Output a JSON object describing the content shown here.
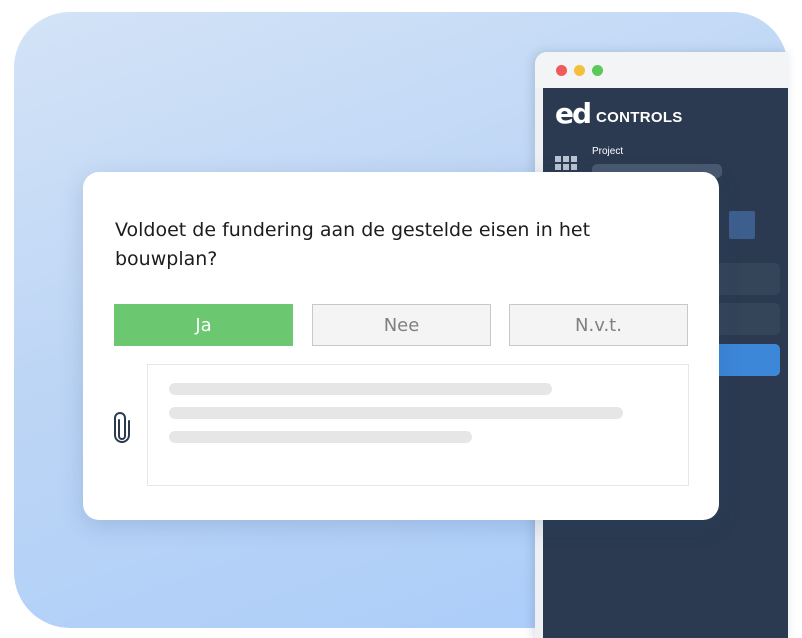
{
  "app": {
    "logo_mark": "ed",
    "logo_text": "CONTROLS",
    "project_label": "Project",
    "window_controls": [
      "close",
      "minimize",
      "maximize"
    ]
  },
  "question_card": {
    "question": "Voldoet de fundering aan de gestelde eisen in het bouwplan?",
    "options": [
      {
        "label": "Ja",
        "selected": true
      },
      {
        "label": "Nee",
        "selected": false
      },
      {
        "label": "N.v.t.",
        "selected": false
      }
    ],
    "attachment_icon": "paperclip-icon"
  },
  "colors": {
    "selected_option": "#6cc870",
    "app_sidebar": "#2b3a50",
    "app_accent": "#3d87d8"
  }
}
